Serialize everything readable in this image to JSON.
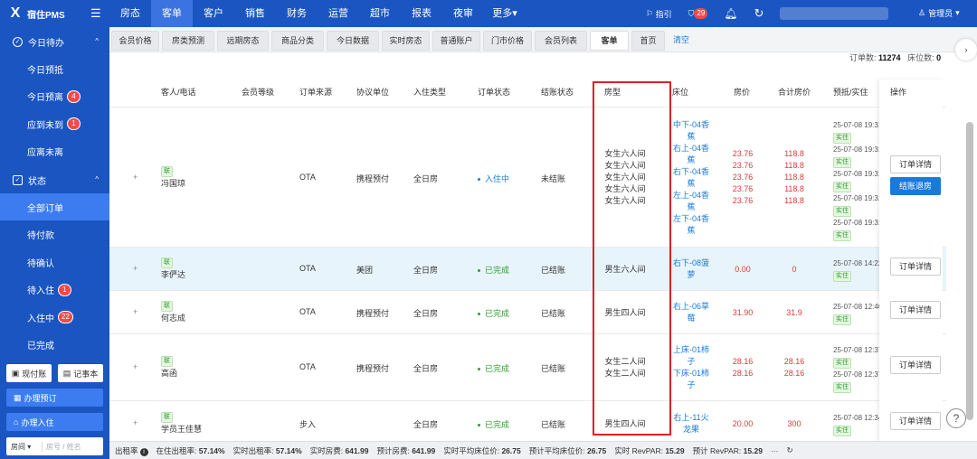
{
  "app": {
    "logo_text": "宿住PMS"
  },
  "nav": [
    "房态",
    "客单",
    "客户",
    "销售",
    "财务",
    "运营",
    "超市",
    "报表",
    "夜审",
    "更多▾"
  ],
  "nav_active": 1,
  "tools": {
    "checkin_label": "指引",
    "badge_count": "29"
  },
  "user": {
    "name": "管理员"
  },
  "sidebar": {
    "group_today": "今日待办",
    "today_items": [
      {
        "label": "今日预抵",
        "badge": ""
      },
      {
        "label": "今日预离",
        "badge": "4"
      },
      {
        "label": "应到未到",
        "badge": "1"
      },
      {
        "label": "应离未离",
        "badge": ""
      }
    ],
    "group_status": "状态",
    "status_items": [
      {
        "label": "全部订单",
        "badge": ""
      },
      {
        "label": "待付款",
        "badge": ""
      },
      {
        "label": "待确认",
        "badge": ""
      },
      {
        "label": "待入住",
        "badge": "1"
      },
      {
        "label": "入住中",
        "badge": "22"
      },
      {
        "label": "已完成",
        "badge": ""
      }
    ],
    "btn_cash": "现付账",
    "btn_notes": "记事本",
    "btn_reserve": "办理预订",
    "btn_checkin": "办理入住",
    "search_select": "房间",
    "search_placeholder": "房号 / 姓名"
  },
  "tabs": [
    "会员价格",
    "房类预测",
    "远期房态",
    "商品分类",
    "今日数据",
    "实时房态",
    "普通账户",
    "门市价格",
    "会员列表",
    "客单",
    "首页",
    "清空"
  ],
  "tab_active": 9,
  "counts": {
    "orders_label": "订单数:",
    "orders": "11274",
    "beds_label": "床位数:",
    "beds": "0"
  },
  "columns": [
    "客人/电话",
    "会员等级",
    "订单来源",
    "协议单位",
    "入住类型",
    "订单状态",
    "结账状态",
    "房型",
    "床位",
    "房价",
    "合计房价",
    "预抵/实住",
    "操作"
  ],
  "rows": [
    {
      "tag": "联",
      "name": "冯国琼",
      "source": "OTA",
      "agreement": "携程预付",
      "type": "全日房",
      "status": "入住中",
      "status_color": "#1a7ad9",
      "checkout": "未结账",
      "room_types": [
        "女生六人间",
        "女生六人间",
        "女生六人间",
        "女生六人间",
        "女生六人间"
      ],
      "beds": [
        "中下-04香蕉",
        "右上-04香蕉",
        "右下-04香蕉",
        "左上-04香蕉",
        "左下-04香蕉"
      ],
      "prices": [
        "23.76",
        "23.76",
        "23.76",
        "23.76",
        "23.76"
      ],
      "totals": [
        "118.8",
        "118.8",
        "118.8",
        "118.8",
        "118.8"
      ],
      "dates": [
        "25-07-08 19:31",
        "25-07-08 19:31",
        "25-07-08 19:31",
        "25-07-08 19:31",
        "25-07-08 19:31"
      ],
      "actions": [
        "订单详情",
        "结账退房"
      ]
    },
    {
      "tag": "联",
      "name": "李俨达",
      "source": "OTA",
      "agreement": "美团",
      "type": "全日房",
      "status": "已完成",
      "status_color": "#2f9a2f",
      "checkout": "已结账",
      "room_types": [
        "男生六人间"
      ],
      "beds": [
        "右下-08菠萝"
      ],
      "prices": [
        "0.00"
      ],
      "totals": [
        "0"
      ],
      "dates": [
        "25-07-08 14:22"
      ],
      "actions": [
        "订单详情"
      ]
    },
    {
      "tag": "联",
      "name": "何志成",
      "source": "OTA",
      "agreement": "携程预付",
      "type": "全日房",
      "status": "已完成",
      "status_color": "#2f9a2f",
      "checkout": "已结账",
      "room_types": [
        "男生四人间"
      ],
      "beds": [
        "右上-06草莓"
      ],
      "prices": [
        "31.90"
      ],
      "totals": [
        "31.9"
      ],
      "dates": [
        "25-07-08 12:40"
      ],
      "actions": [
        "订单详情"
      ]
    },
    {
      "tag": "联",
      "name": "高函",
      "source": "OTA",
      "agreement": "携程预付",
      "type": "全日房",
      "status": "已完成",
      "status_color": "#2f9a2f",
      "checkout": "已结账",
      "room_types": [
        "女生二人间",
        "女生二人间"
      ],
      "beds": [
        "上床-01柿子",
        "下床-01柿子"
      ],
      "prices": [
        "28.16",
        "28.16"
      ],
      "totals": [
        "28.16",
        "28.16"
      ],
      "dates": [
        "25-07-08 12:37",
        "25-07-08 12:37"
      ],
      "actions": [
        "订单详情"
      ]
    },
    {
      "tag": "联",
      "name": "学员王佳慧",
      "source": "步入",
      "agreement": "",
      "type": "全日房",
      "status": "已完成",
      "status_color": "#2f9a2f",
      "checkout": "已结账",
      "room_types": [
        "男生四人间"
      ],
      "beds": [
        "右上-11火龙果"
      ],
      "prices": [
        "20.00"
      ],
      "totals": [
        "300"
      ],
      "dates": [
        "25-07-08 12:34"
      ],
      "actions": [
        "订单详情"
      ]
    }
  ],
  "shi_label": "实住",
  "footer": [
    {
      "label": "出租率",
      "value": ""
    },
    {
      "label": "在住出租率:",
      "value": "57.14%"
    },
    {
      "label": "实时出租率:",
      "value": "57.14%"
    },
    {
      "label": "实时房费:",
      "value": "641.99"
    },
    {
      "label": "预计房费:",
      "value": "641.99"
    },
    {
      "label": "实时平均床位价:",
      "value": "26.75"
    },
    {
      "label": "预计平均床位价:",
      "value": "26.75"
    },
    {
      "label": "实时 RevPAR:",
      "value": "15.29"
    },
    {
      "label": "预计 RevPAR:",
      "value": "15.29"
    },
    {
      "label": "···",
      "value": ""
    }
  ]
}
